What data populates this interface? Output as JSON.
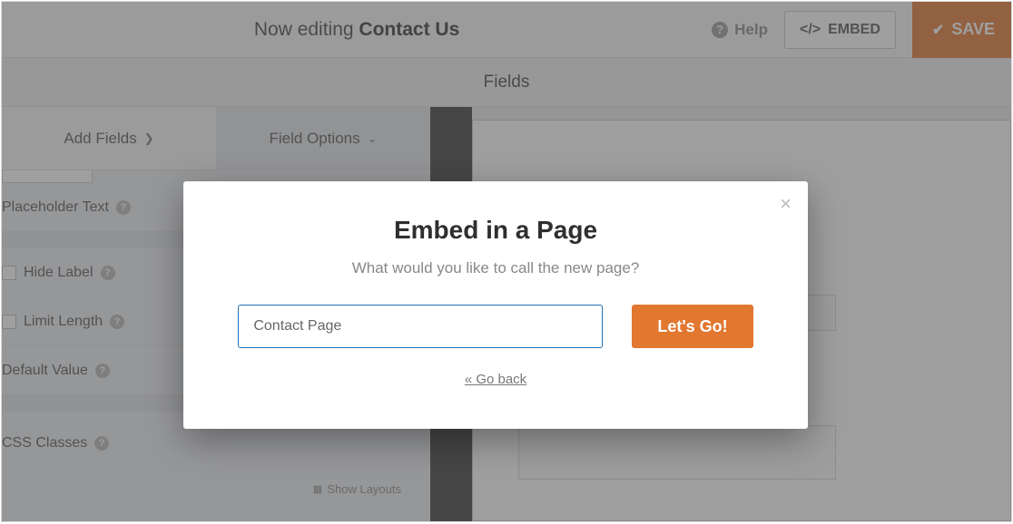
{
  "header": {
    "editing_prefix": "Now editing",
    "form_name": "Contact Us",
    "help_label": "Help",
    "embed_label": "EMBED",
    "save_label": "SAVE"
  },
  "subheader": {
    "title": "Fields"
  },
  "left": {
    "tab_add": "Add Fields",
    "tab_options": "Field Options",
    "placeholder_text": "Placeholder Text",
    "hide_label": "Hide Label",
    "limit_length": "Limit Length",
    "default_value": "Default Value",
    "css_classes": "CSS Classes",
    "show_layouts": "Show Layouts"
  },
  "modal": {
    "title": "Embed in a Page",
    "subtitle": "What would you like to call the new page?",
    "input_value": "Contact Page",
    "go_label": "Let's Go!",
    "back_label": "« Go back"
  }
}
